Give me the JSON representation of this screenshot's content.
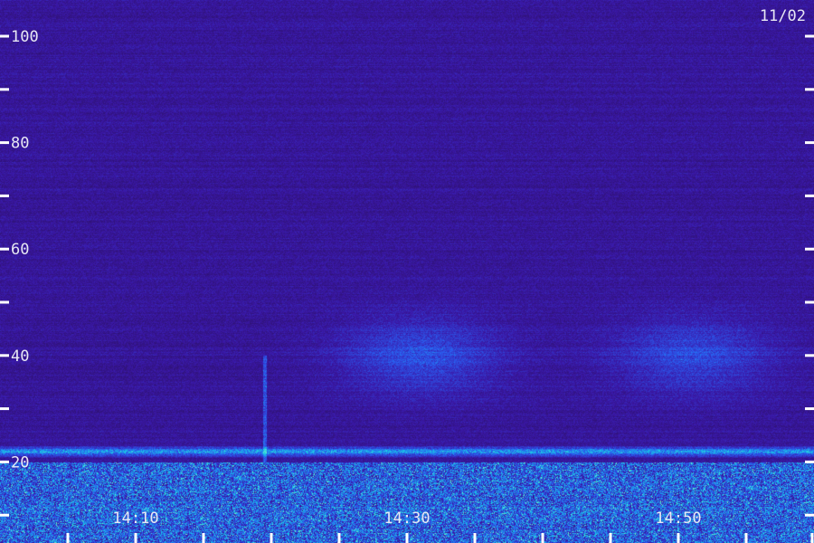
{
  "date_label": "11/02",
  "chart_data": {
    "type": "heatmap",
    "title": "",
    "xlabel": "",
    "ylabel": "",
    "x_tick_labels": [
      "14:10",
      "14:30",
      "14:50"
    ],
    "x_ticks_major_minutes": [
      10,
      30,
      50
    ],
    "x_ticks_minor_minutes": [
      5,
      15,
      20,
      25,
      35,
      40,
      45,
      55,
      60
    ],
    "y_tick_labels": [
      "100",
      "80",
      "60",
      "40",
      "20"
    ],
    "y_ticks_labeled": [
      100,
      80,
      60,
      40,
      20
    ],
    "y_ticks_unlabeled": [
      90,
      70,
      50,
      30,
      10
    ],
    "xlim_minutes": [
      5,
      65
    ],
    "ylim": [
      0,
      102
    ],
    "time_origin": "14:00",
    "colormap": [
      "#2a0f5c",
      "#3a18a8",
      "#2a5cf0",
      "#16c8e6",
      "#6af0c8"
    ],
    "features": [
      {
        "name": "noise band",
        "y_range": [
          0,
          20
        ],
        "intensity": 0.55
      },
      {
        "name": "horizontal streak",
        "y": 22,
        "intensity": 0.6
      },
      {
        "name": "faint blob",
        "x_minutes": 31,
        "y": 40,
        "intensity": 0.3
      },
      {
        "name": "faint blob",
        "x_minutes": 51,
        "y": 40,
        "intensity": 0.28
      },
      {
        "name": "vertical streak",
        "x_minutes": 19.5,
        "y_range": [
          20,
          40
        ],
        "intensity": 0.35
      }
    ]
  }
}
